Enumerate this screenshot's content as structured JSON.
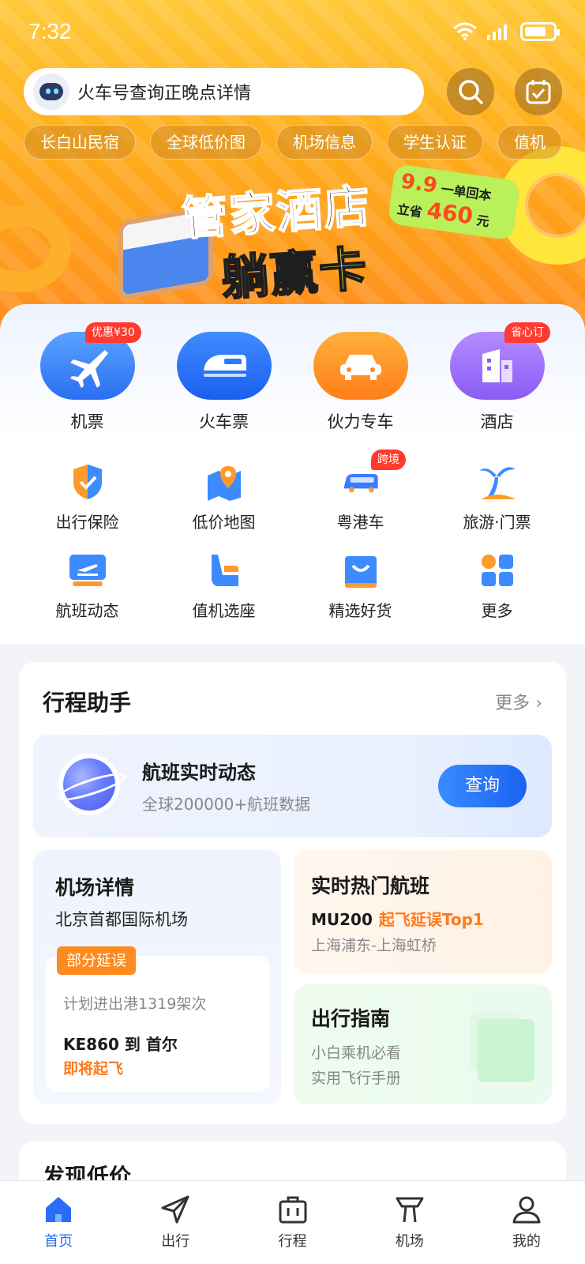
{
  "status_bar": {
    "time": "7:32"
  },
  "search": {
    "placeholder_text": "火车号查询正晚点详情"
  },
  "chips": [
    "长白山民宿",
    "全球低价图",
    "机场信息",
    "学生认证",
    "值机"
  ],
  "banner": {
    "title": "管家酒店",
    "subtitle": "躺赢卡",
    "badge_price": "9.9",
    "badge_text1": "一单回本",
    "badge_text2": "立省",
    "badge_amount": "460",
    "badge_unit": "元"
  },
  "main_services": [
    {
      "label": "机票",
      "tag": "优惠¥30",
      "icon": "airplane-icon",
      "color": "#3d8bff"
    },
    {
      "label": "火车票",
      "tag": "",
      "icon": "train-icon",
      "color": "#2c7bff"
    },
    {
      "label": "伙力专车",
      "tag": "",
      "icon": "car-icon",
      "color": "#ff9a2a"
    },
    {
      "label": "酒店",
      "tag": "省心订",
      "icon": "hotel-icon",
      "color": "#9a6cff"
    }
  ],
  "sub_services_row1": [
    {
      "label": "出行保险",
      "tag": "",
      "icon": "shield-icon"
    },
    {
      "label": "低价地图",
      "tag": "",
      "icon": "map-pin-icon"
    },
    {
      "label": "粤港车",
      "tag": "跨境",
      "icon": "bus-icon"
    },
    {
      "label": "旅游·门票",
      "tag": "",
      "icon": "palm-tree-icon"
    }
  ],
  "sub_services_row2": [
    {
      "label": "航班动态",
      "tag": "",
      "icon": "flight-board-icon"
    },
    {
      "label": "值机选座",
      "tag": "",
      "icon": "seat-icon"
    },
    {
      "label": "精选好货",
      "tag": "",
      "icon": "shopping-bag-icon"
    },
    {
      "label": "更多",
      "tag": "",
      "icon": "grid-icon"
    }
  ],
  "trip_assistant": {
    "title": "行程助手",
    "more": "更多",
    "flight_live": {
      "title": "航班实时动态",
      "subtitle": "全球200000+航班数据",
      "button": "查询"
    },
    "airport": {
      "title": "机场详情",
      "name": "北京首都国际机场",
      "delay_tag": "部分延误",
      "count": "计划进出港1319架次",
      "flight": "KE860 到 首尔",
      "status": "即将起飞"
    },
    "hot_flight": {
      "title": "实时热门航班",
      "code": "MU200",
      "highlight": "起飞延误Top1",
      "route": "上海浦东-上海虹桥"
    },
    "guide": {
      "title": "出行指南",
      "line1": "小白乘机必看",
      "line2": "实用飞行手册"
    }
  },
  "discover": {
    "title": "发现低价"
  },
  "tabs": [
    {
      "label": "首页",
      "icon": "home-icon",
      "active": true
    },
    {
      "label": "出行",
      "icon": "paper-plane-icon",
      "active": false
    },
    {
      "label": "行程",
      "icon": "briefcase-icon",
      "active": false
    },
    {
      "label": "机场",
      "icon": "tower-icon",
      "active": false
    },
    {
      "label": "我的",
      "icon": "user-icon",
      "active": false
    }
  ],
  "colors": {
    "accent": "#2a6cf5",
    "orange": "#ff7a1a",
    "tag_red": "#ff3b30"
  }
}
